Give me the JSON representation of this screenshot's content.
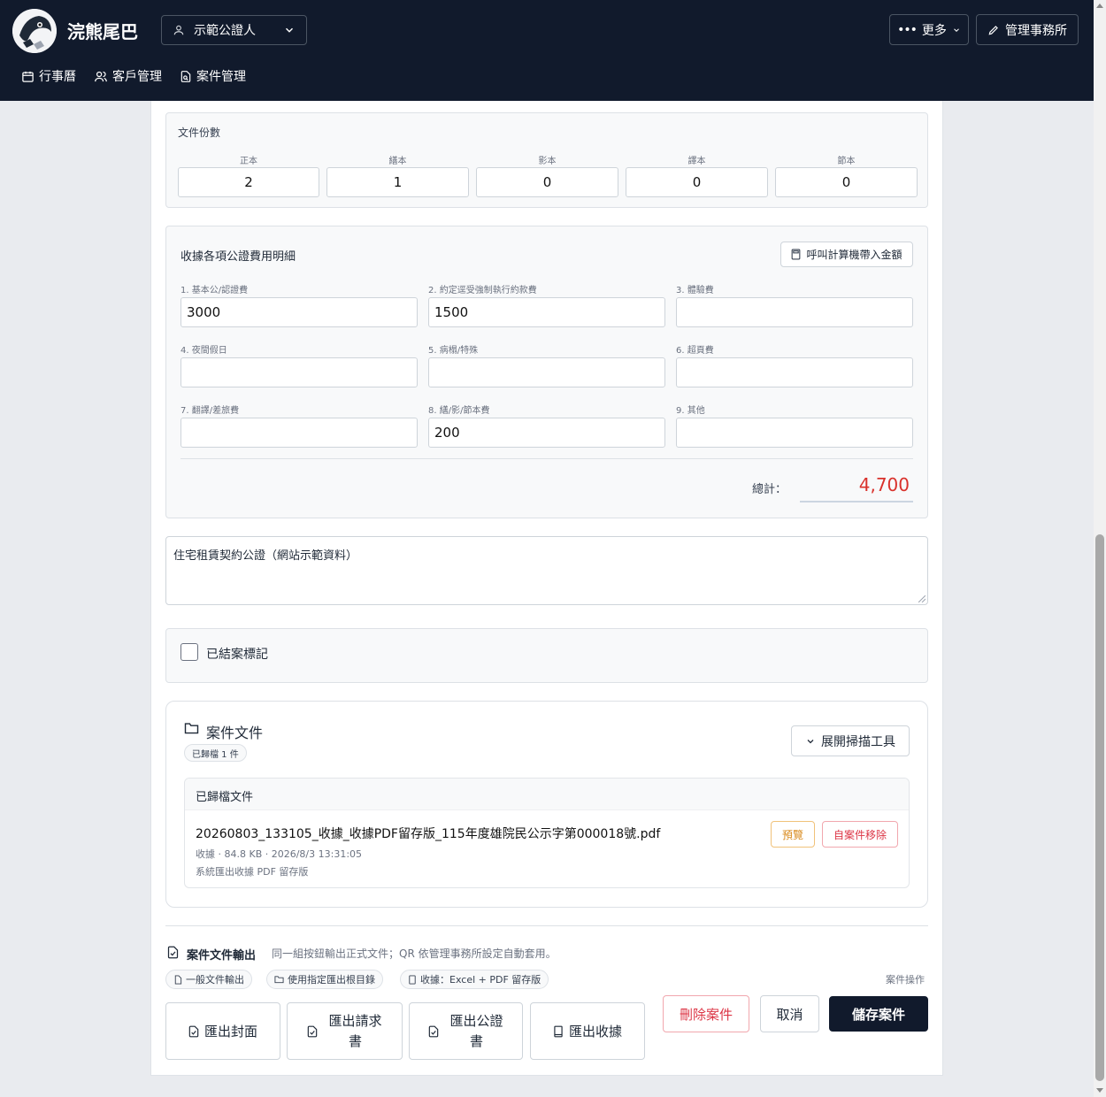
{
  "header": {
    "brand": "浣熊尾巴",
    "user_select": "示範公證人",
    "more_label": "更多",
    "manage_label": "管理事務所",
    "nav": [
      {
        "label": "行事曆",
        "icon": "calendar-icon"
      },
      {
        "label": "客戶管理",
        "icon": "users-icon"
      },
      {
        "label": "案件管理",
        "icon": "file-search-icon"
      }
    ]
  },
  "copies": {
    "title": "文件份數",
    "fields": [
      {
        "label": "正本",
        "value": "2"
      },
      {
        "label": "繕本",
        "value": "1"
      },
      {
        "label": "影本",
        "value": "0"
      },
      {
        "label": "譯本",
        "value": "0"
      },
      {
        "label": "節本",
        "value": "0"
      }
    ]
  },
  "fees": {
    "title": "收據各項公證費用明細",
    "calc_button": "呼叫計算機帶入金額",
    "fields": [
      {
        "label": "1. 基本公/認證費",
        "value": "3000"
      },
      {
        "label": "2. 約定逕受強制執行約款費",
        "value": "1500"
      },
      {
        "label": "3. 體驗費",
        "value": ""
      },
      {
        "label": "4. 夜間假日",
        "value": ""
      },
      {
        "label": "5. 病榻/特殊",
        "value": ""
      },
      {
        "label": "6. 超頁費",
        "value": ""
      },
      {
        "label": "7. 翻譯/差旅費",
        "value": ""
      },
      {
        "label": "8. 繕/影/節本費",
        "value": "200"
      },
      {
        "label": "9. 其他",
        "value": ""
      }
    ],
    "total_label": "總計：",
    "total_value": "4,700"
  },
  "note": "住宅租賃契約公證（網站示範資料）",
  "closed_label": "已結案標記",
  "documents": {
    "title": "案件文件",
    "count_badge": "已歸檔 1 件",
    "scan_button": "展開掃描工具",
    "list_title": "已歸檔文件",
    "items": [
      {
        "name": "20260803_133105_收據_收據PDF留存版_115年度雄院民公示字第000018號.pdf",
        "meta": "收據 · 84.8 KB · 2026/8/3 13:31:05",
        "desc": "系統匯出收據 PDF 留存版",
        "preview": "預覽",
        "remove": "自案件移除"
      }
    ]
  },
  "export": {
    "title": "案件文件輸出",
    "hint": "同一組按鈕輸出正式文件；QR 依管理事務所設定自動套用。",
    "pills": [
      "一般文件輸出",
      "使用指定匯出根目錄",
      "收據：Excel + PDF 留存版"
    ],
    "buttons": [
      "匯出封面",
      "匯出請求書",
      "匯出公證書",
      "匯出收據"
    ],
    "button_lines": [
      [
        "匯出封面"
      ],
      [
        "匯出請求",
        "書"
      ],
      [
        "匯出公證",
        "書"
      ],
      [
        "匯出收據"
      ]
    ]
  },
  "actions": {
    "label": "案件操作",
    "delete": "刪除案件",
    "cancel": "取消",
    "save": "儲存案件"
  },
  "colors": {
    "topbar": "#111a2c",
    "total_red": "#d9312b",
    "save_button": "#111a2c",
    "preview_orange": "#d98b1f",
    "delete_red": "#dc3545"
  }
}
